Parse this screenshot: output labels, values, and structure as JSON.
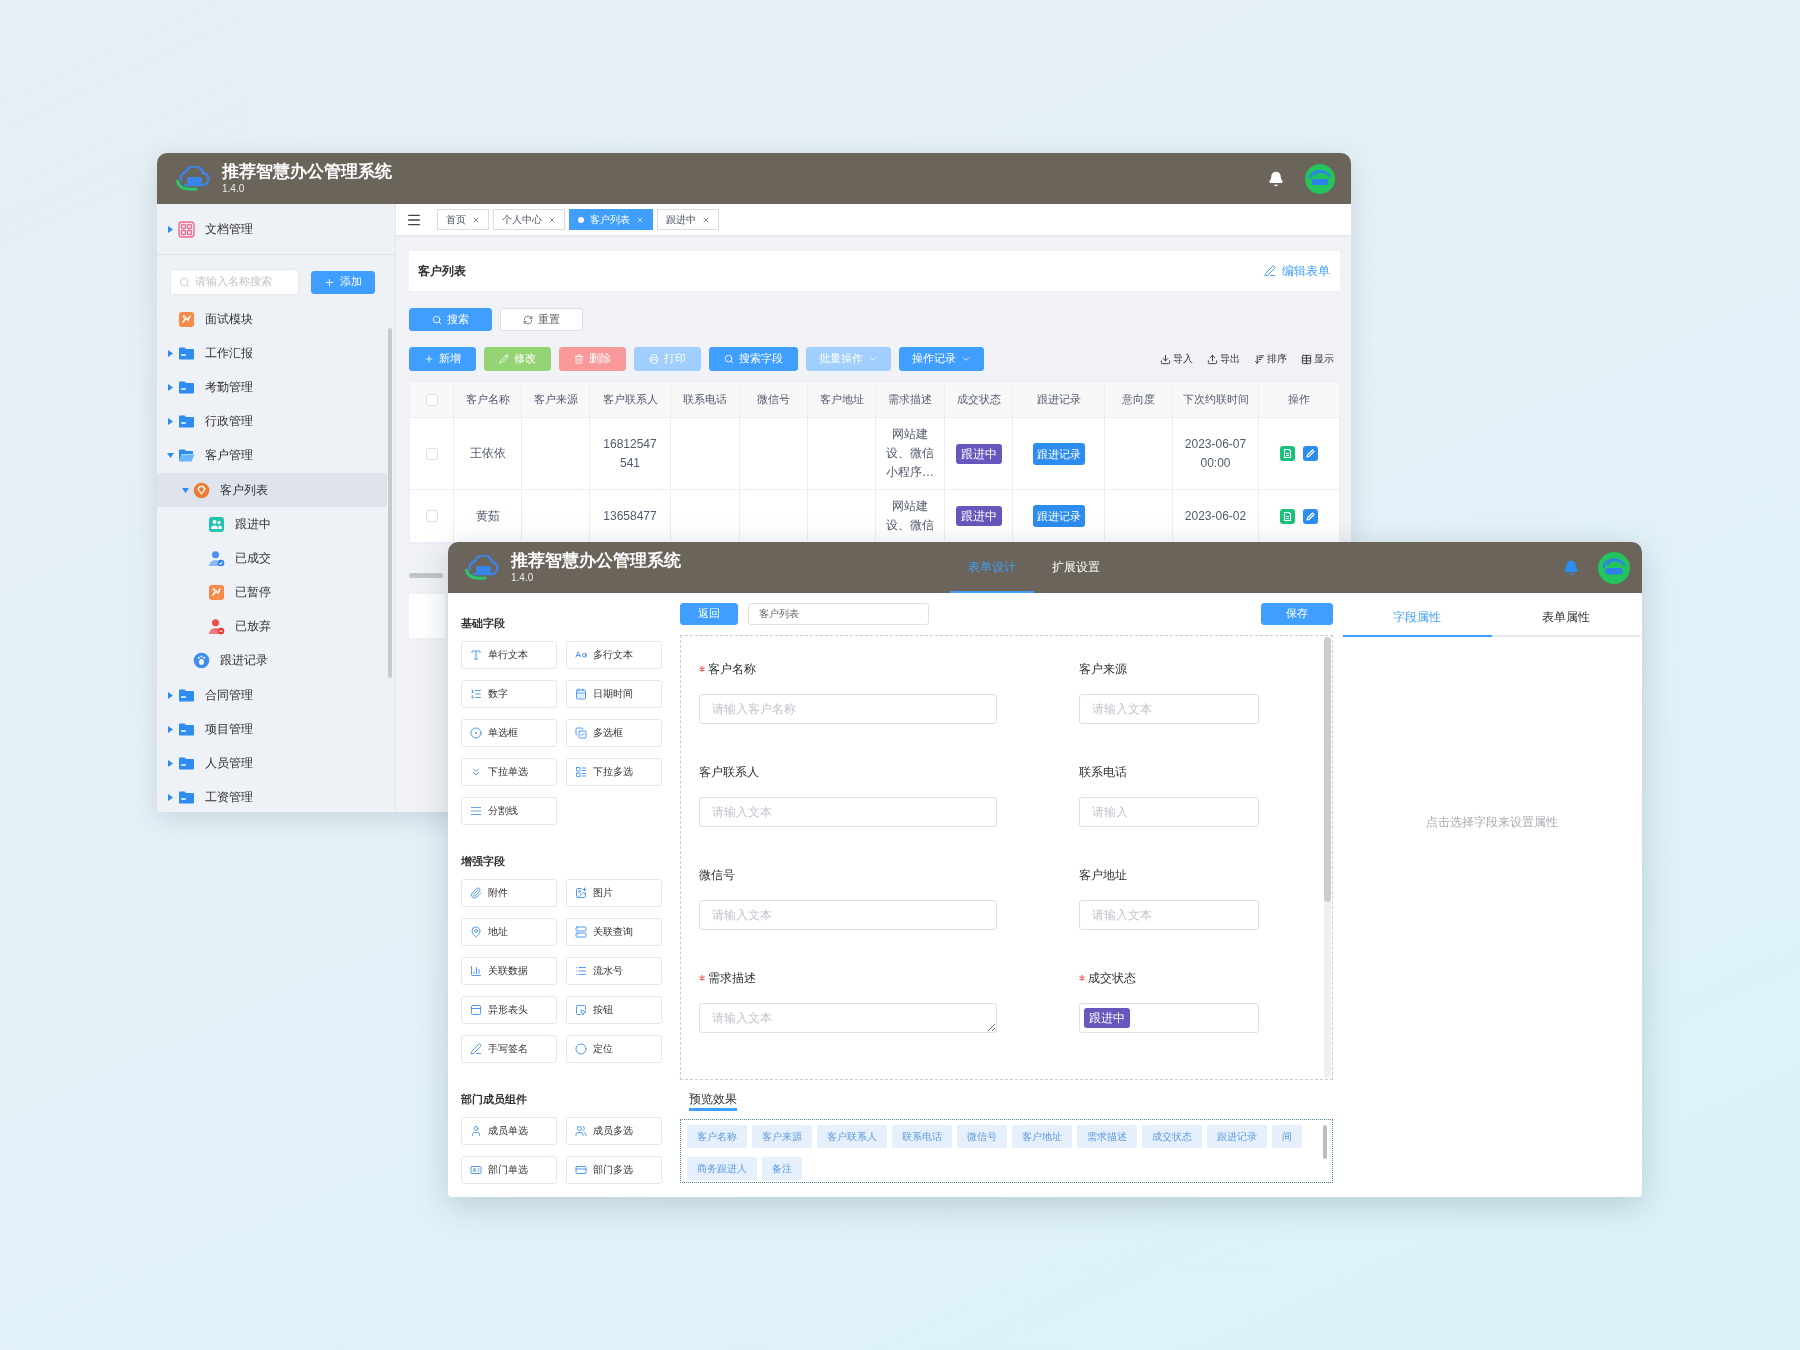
{
  "back_window": {
    "header": {
      "title": "推荐智慧办公管理系统",
      "version": "1.4.0"
    },
    "sidebar": {
      "top_item": {
        "label": "文档管理",
        "kind": "apps",
        "expanded": false,
        "selected": false
      },
      "search": {
        "placeholder": "请输入名称搜索"
      },
      "add_button": "添加",
      "items": [
        {
          "label": "面试模块",
          "kind": "tile",
          "selected": false
        },
        {
          "label": "工作汇报",
          "kind": "folder",
          "expanded": false,
          "selected": false
        },
        {
          "label": "考勤管理",
          "kind": "folder",
          "expanded": false,
          "selected": false
        },
        {
          "label": "行政管理",
          "kind": "folder",
          "expanded": false,
          "selected": false
        },
        {
          "label": "客户管理",
          "kind": "folder",
          "expanded": true,
          "selected": false,
          "children": [
            {
              "label": "客户列表",
              "kind": "medal",
              "expanded": true,
              "selected": true,
              "children": [
                {
                  "label": "跟进中",
                  "kind": "team",
                  "selected": false
                },
                {
                  "label": "已成交",
                  "kind": "approved",
                  "selected": false
                },
                {
                  "label": "已暂停",
                  "kind": "tile",
                  "selected": false
                },
                {
                  "label": "已放弃",
                  "kind": "declined",
                  "selected": false
                }
              ]
            },
            {
              "label": "跟进记录",
              "kind": "footprint",
              "selected": false
            }
          ]
        },
        {
          "label": "合同管理",
          "kind": "folder",
          "expanded": false,
          "selected": false
        },
        {
          "label": "项目管理",
          "kind": "folder",
          "expanded": false,
          "selected": false
        },
        {
          "label": "人员管理",
          "kind": "folder",
          "expanded": false,
          "selected": false
        },
        {
          "label": "工资管理",
          "kind": "folder",
          "expanded": false,
          "selected": false
        }
      ]
    },
    "tabs": [
      {
        "label": "首页",
        "selected": false
      },
      {
        "label": "个人中心",
        "selected": false
      },
      {
        "label": "客户列表",
        "selected": true
      },
      {
        "label": "跟进中",
        "selected": false
      }
    ],
    "page_title": "客户列表",
    "edit_link": "编辑表单",
    "search_buttons": [
      {
        "label": "搜索",
        "kind": "search"
      },
      {
        "label": "重置",
        "kind": "reset"
      }
    ],
    "toolbar": [
      {
        "label": "新增",
        "kind": "add",
        "disabled": false
      },
      {
        "label": "修改",
        "kind": "edit",
        "disabled": true
      },
      {
        "label": "删除",
        "kind": "delete",
        "disabled": true
      },
      {
        "label": "打印",
        "kind": "print",
        "disabled": true
      },
      {
        "label": "搜索字段",
        "kind": "search",
        "disabled": false
      },
      {
        "label": "批量操作",
        "kind": "dropdown",
        "disabled": true
      },
      {
        "label": "操作记录",
        "kind": "dropdown",
        "disabled": false
      }
    ],
    "tools": [
      {
        "label": "导入",
        "kind": "import"
      },
      {
        "label": "导出",
        "kind": "export"
      },
      {
        "label": "排序",
        "kind": "sort"
      },
      {
        "label": "显示",
        "kind": "columns"
      }
    ],
    "table": {
      "select_all": {
        "checked": false
      },
      "columns": [
        "客户名称",
        "客户来源",
        "客户联系人",
        "联系电话",
        "微信号",
        "客户地址",
        "需求描述",
        "成交状态",
        "跟进记录",
        "意向度",
        "下次约联时间",
        "操作"
      ],
      "rows": [
        {
          "checked": false,
          "name": "王依依",
          "contact": "16812547541",
          "demand": "网站建设、微信小程序…",
          "status": "跟进中",
          "follow_up": "跟进记录",
          "next_contact": "2023-06-07 00:00"
        },
        {
          "checked": false,
          "name": "黄茹",
          "contact": "13658477",
          "demand": "网站建设、微信",
          "status": "跟进中",
          "follow_up": "跟进记录",
          "next_contact": "2023-06-02"
        }
      ]
    }
  },
  "front_window": {
    "header": {
      "title": "推荐智慧办公管理系统",
      "version": "1.4.0",
      "tabs": [
        {
          "label": "表单设计",
          "selected": true
        },
        {
          "label": "扩展设置",
          "selected": false
        }
      ]
    },
    "palette": [
      {
        "title": "基础字段",
        "items": [
          {
            "label": "单行文本",
            "kind": "text"
          },
          {
            "label": "多行文本",
            "kind": "textarea"
          },
          {
            "label": "数字",
            "kind": "number"
          },
          {
            "label": "日期时间",
            "kind": "datetime"
          },
          {
            "label": "单选框",
            "kind": "radio"
          },
          {
            "label": "多选框",
            "kind": "checkbox"
          },
          {
            "label": "下拉单选",
            "kind": "select"
          },
          {
            "label": "下拉多选",
            "kind": "multiselect"
          },
          {
            "label": "分割线",
            "kind": "divider"
          }
        ]
      },
      {
        "title": "增强字段",
        "items": [
          {
            "label": "附件",
            "kind": "attachment"
          },
          {
            "label": "图片",
            "kind": "image"
          },
          {
            "label": "地址",
            "kind": "address"
          },
          {
            "label": "关联查询",
            "kind": "lookup"
          },
          {
            "label": "关联数据",
            "kind": "relation"
          },
          {
            "label": "流水号",
            "kind": "serial"
          },
          {
            "label": "异形表头",
            "kind": "header"
          },
          {
            "label": "按钮",
            "kind": "button"
          },
          {
            "label": "手写签名",
            "kind": "signature"
          },
          {
            "label": "定位",
            "kind": "location"
          }
        ]
      },
      {
        "title": "部门成员组件",
        "items": [
          {
            "label": "成员单选",
            "kind": "member"
          },
          {
            "label": "成员多选",
            "kind": "members"
          },
          {
            "label": "部门单选",
            "kind": "department"
          },
          {
            "label": "部门多选",
            "kind": "departments"
          }
        ]
      }
    ],
    "designer": {
      "back_button": "返回",
      "form_name": "客户列表",
      "save_button": "保存",
      "fields": [
        {
          "label": "客户名称",
          "required": true,
          "kind": "input",
          "placeholder": "请输入客户名称"
        },
        {
          "label": "客户来源",
          "required": false,
          "kind": "input",
          "placeholder": "请输入文本"
        },
        {
          "label": "客户联系人",
          "required": false,
          "kind": "input",
          "placeholder": "请输入文本"
        },
        {
          "label": "联系电话",
          "required": false,
          "kind": "input",
          "placeholder": "请输入"
        },
        {
          "label": "微信号",
          "required": false,
          "kind": "input",
          "placeholder": "请输入文本"
        },
        {
          "label": "客户地址",
          "required": false,
          "kind": "input",
          "placeholder": "请输入文本"
        },
        {
          "label": "需求描述",
          "required": true,
          "kind": "textarea",
          "placeholder": "请输入文本"
        },
        {
          "label": "成交状态",
          "required": true,
          "kind": "tag",
          "value": "跟进中"
        }
      ],
      "preview": {
        "title": "预览效果",
        "chips": [
          "客户名称",
          "客户来源",
          "客户联系人",
          "联系电话",
          "微信号",
          "客户地址",
          "需求描述",
          "成交状态",
          "跟进记录",
          "间",
          "商务跟进人",
          "备注"
        ]
      }
    },
    "properties": {
      "tabs": [
        {
          "label": "字段属性",
          "selected": true
        },
        {
          "label": "表单属性",
          "selected": false
        }
      ],
      "empty_text": "点击选择字段来设置属性"
    }
  }
}
